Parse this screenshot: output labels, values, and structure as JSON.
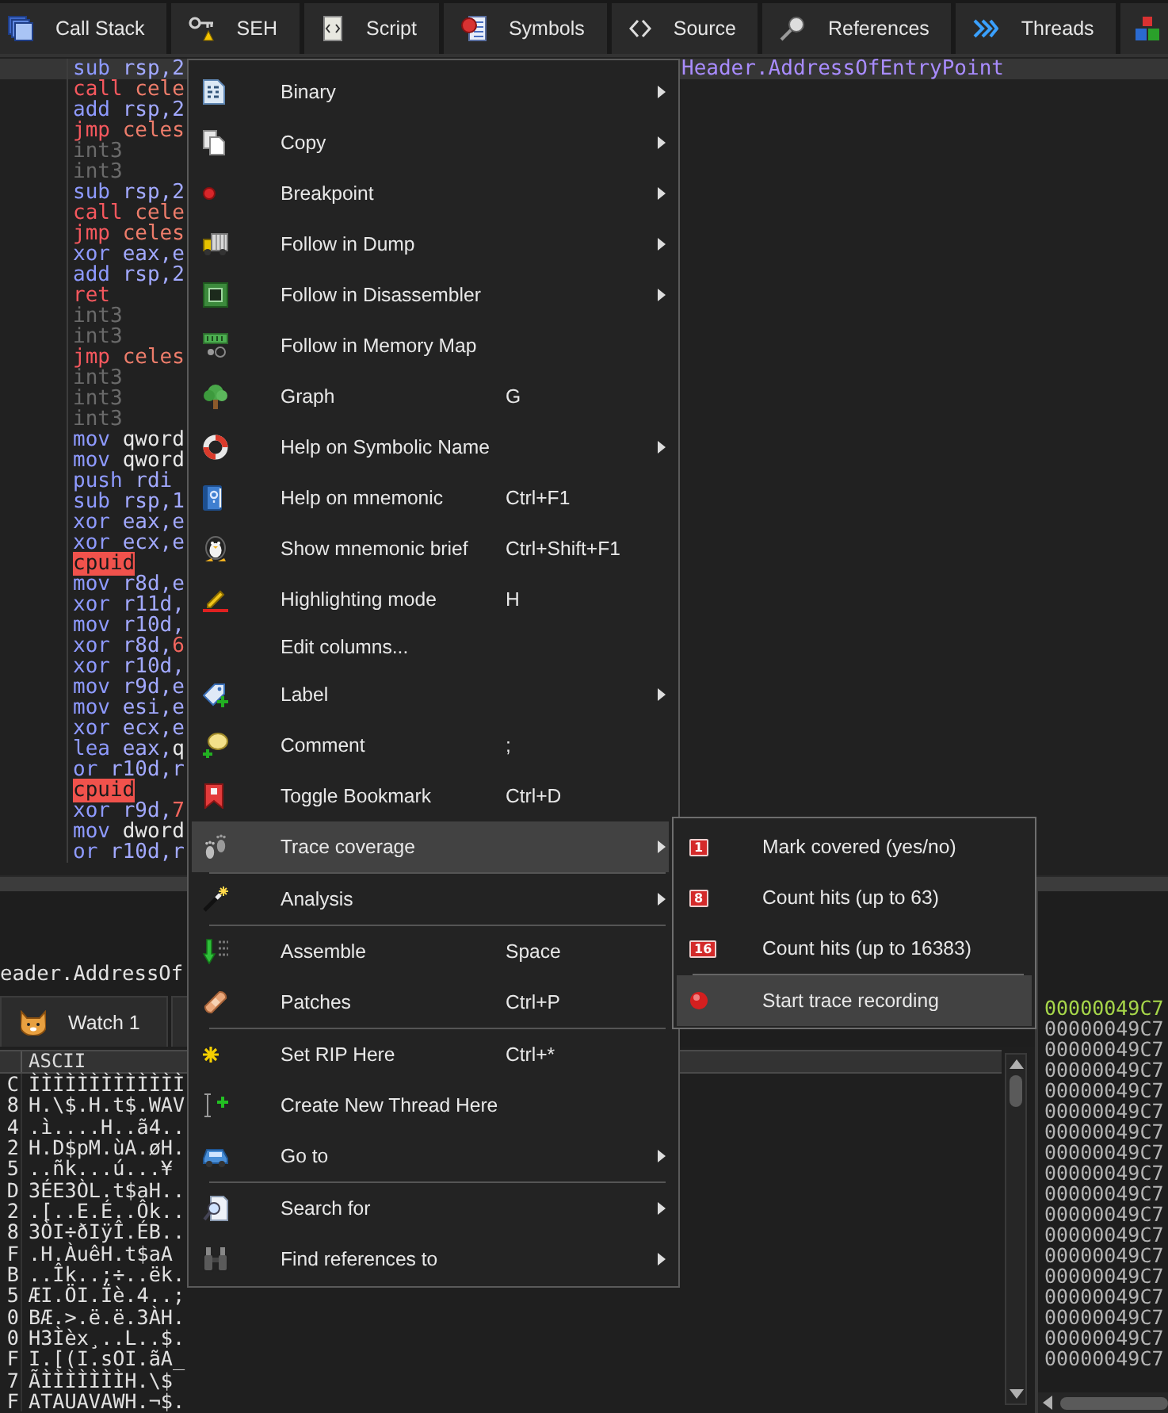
{
  "toolbar_tabs": [
    {
      "label": "Call Stack",
      "selected": false
    },
    {
      "label": "SEH",
      "selected": false
    },
    {
      "label": "Script",
      "selected": false
    },
    {
      "label": "Symbols",
      "selected": false
    },
    {
      "label": "Source",
      "selected": false
    },
    {
      "label": "References",
      "selected": false
    },
    {
      "label": "Threads",
      "selected": false
    },
    {
      "selected": false
    }
  ],
  "disassembly": {
    "lines": [
      {
        "mnemonic": "sub",
        "kind": "arith",
        "operands": [
          {
            "text": "rsp,2",
            "kind": "reg"
          }
        ],
        "comment": "Header.AddressOfEntryPoint",
        "selected": true
      },
      {
        "mnemonic": "call",
        "kind": "branch",
        "operands": [
          {
            "text": "cele",
            "kind": "symbol"
          }
        ],
        "selected": false
      },
      {
        "mnemonic": "add",
        "kind": "arith",
        "operands": [
          {
            "text": "rsp,2",
            "kind": "reg"
          }
        ],
        "selected": false
      },
      {
        "mnemonic": "jmp",
        "kind": "branch",
        "operands": [
          {
            "text": "celes",
            "kind": "symbol"
          }
        ],
        "selected": false
      },
      {
        "mnemonic": "int3",
        "kind": "filler",
        "selected": false
      },
      {
        "mnemonic": "int3",
        "kind": "filler",
        "selected": false
      },
      {
        "mnemonic": "sub",
        "kind": "arith",
        "operands": [
          {
            "text": "rsp,2",
            "kind": "reg"
          }
        ],
        "selected": false
      },
      {
        "mnemonic": "call",
        "kind": "branch",
        "operands": [
          {
            "text": "cele",
            "kind": "symbol"
          }
        ],
        "selected": false
      },
      {
        "mnemonic": "jmp",
        "kind": "branch",
        "operands": [
          {
            "text": "celes",
            "kind": "symbol"
          }
        ],
        "selected": false
      },
      {
        "mnemonic": "xor",
        "kind": "arith",
        "operands": [
          {
            "text": "eax,e",
            "kind": "reg"
          }
        ],
        "selected": false
      },
      {
        "mnemonic": "add",
        "kind": "arith",
        "operands": [
          {
            "text": "rsp,2",
            "kind": "reg"
          }
        ],
        "selected": false
      },
      {
        "mnemonic": "ret",
        "kind": "branch",
        "selected": false
      },
      {
        "mnemonic": "int3",
        "kind": "filler",
        "selected": false
      },
      {
        "mnemonic": "int3",
        "kind": "filler",
        "selected": false
      },
      {
        "mnemonic": "jmp",
        "kind": "branch",
        "operands": [
          {
            "text": "celes",
            "kind": "symbol"
          }
        ],
        "selected": false
      },
      {
        "mnemonic": "int3",
        "kind": "filler",
        "selected": false
      },
      {
        "mnemonic": "int3",
        "kind": "filler",
        "selected": false
      },
      {
        "mnemonic": "int3",
        "kind": "filler",
        "selected": false
      },
      {
        "mnemonic": "mov",
        "kind": "arith",
        "operands": [
          {
            "text": "qword",
            "kind": "mem"
          }
        ],
        "selected": false
      },
      {
        "mnemonic": "mov",
        "kind": "arith",
        "operands": [
          {
            "text": "qword",
            "kind": "mem"
          }
        ],
        "selected": false
      },
      {
        "mnemonic": "push",
        "kind": "arith",
        "operands": [
          {
            "text": "rdi",
            "kind": "reg"
          }
        ],
        "selected": false
      },
      {
        "mnemonic": "sub",
        "kind": "arith",
        "operands": [
          {
            "text": "rsp,1",
            "kind": "reg"
          }
        ],
        "selected": false
      },
      {
        "mnemonic": "xor",
        "kind": "arith",
        "operands": [
          {
            "text": "eax,e",
            "kind": "reg"
          }
        ],
        "selected": false
      },
      {
        "mnemonic": "xor",
        "kind": "arith",
        "operands": [
          {
            "text": "ecx,e",
            "kind": "reg"
          }
        ],
        "selected": false
      },
      {
        "mnemonic": "cpuid",
        "kind": "flagged",
        "selected": false
      },
      {
        "mnemonic": "mov",
        "kind": "arith",
        "operands": [
          {
            "text": "r8d,e",
            "kind": "reg"
          }
        ],
        "selected": false
      },
      {
        "mnemonic": "xor",
        "kind": "arith",
        "operands": [
          {
            "text": "r11d,",
            "kind": "reg"
          }
        ],
        "selected": false
      },
      {
        "mnemonic": "mov",
        "kind": "arith",
        "operands": [
          {
            "text": "r10d,",
            "kind": "reg"
          }
        ],
        "selected": false
      },
      {
        "mnemonic": "xor",
        "kind": "arith",
        "operands": [
          {
            "text": "r8d,",
            "kind": "reg"
          },
          {
            "text": "6",
            "kind": "imm"
          }
        ],
        "selected": false
      },
      {
        "mnemonic": "xor",
        "kind": "arith",
        "operands": [
          {
            "text": "r10d,",
            "kind": "reg"
          }
        ],
        "selected": false
      },
      {
        "mnemonic": "mov",
        "kind": "arith",
        "operands": [
          {
            "text": "r9d,e",
            "kind": "reg"
          }
        ],
        "selected": false
      },
      {
        "mnemonic": "mov",
        "kind": "arith",
        "operands": [
          {
            "text": "esi,e",
            "kind": "reg"
          }
        ],
        "selected": false
      },
      {
        "mnemonic": "xor",
        "kind": "arith",
        "operands": [
          {
            "text": "ecx,e",
            "kind": "reg"
          }
        ],
        "selected": false
      },
      {
        "mnemonic": "lea",
        "kind": "arith",
        "operands": [
          {
            "text": "eax,",
            "kind": "reg"
          },
          {
            "text": "q",
            "kind": "mem"
          }
        ],
        "selected": false
      },
      {
        "mnemonic": "or",
        "kind": "arith",
        "operands": [
          {
            "text": "r10d,r",
            "kind": "reg"
          }
        ],
        "selected": false
      },
      {
        "mnemonic": "cpuid",
        "kind": "flagged",
        "selected": false
      },
      {
        "mnemonic": "xor",
        "kind": "arith",
        "operands": [
          {
            "text": "r9d,",
            "kind": "reg"
          },
          {
            "text": "7",
            "kind": "imm"
          }
        ],
        "selected": false
      },
      {
        "mnemonic": "mov",
        "kind": "arith",
        "operands": [
          {
            "text": "dword",
            "kind": "mem"
          }
        ],
        "selected": false
      },
      {
        "mnemonic": "or",
        "kind": "arith",
        "operands": [
          {
            "text": "r10d,r",
            "kind": "reg"
          }
        ],
        "selected": false
      }
    ]
  },
  "context_menu": {
    "items": [
      {
        "kind": "command",
        "label": "Binary",
        "submenu": true,
        "selected": false
      },
      {
        "kind": "command",
        "label": "Copy",
        "submenu": true,
        "selected": false
      },
      {
        "kind": "command",
        "label": "Breakpoint",
        "submenu": true,
        "selected": false
      },
      {
        "kind": "command",
        "label": "Follow in Dump",
        "submenu": true,
        "selected": false
      },
      {
        "kind": "command",
        "label": "Follow in Disassembler",
        "submenu": true,
        "selected": false
      },
      {
        "kind": "command",
        "label": "Follow in Memory Map",
        "submenu": false,
        "selected": false
      },
      {
        "kind": "command",
        "label": "Graph",
        "shortcut": "G",
        "submenu": false,
        "selected": false
      },
      {
        "kind": "command",
        "label": "Help on Symbolic Name",
        "submenu": true,
        "selected": false
      },
      {
        "kind": "command",
        "label": "Help on mnemonic",
        "shortcut": "Ctrl+F1",
        "submenu": false,
        "selected": false
      },
      {
        "kind": "command",
        "label": "Show mnemonic brief",
        "shortcut": "Ctrl+Shift+F1",
        "submenu": false,
        "selected": false
      },
      {
        "kind": "command",
        "label": "Highlighting mode",
        "shortcut": "H",
        "submenu": false,
        "selected": false
      },
      {
        "kind": "command",
        "label": "Edit columns...",
        "submenu": false,
        "selected": false
      },
      {
        "kind": "command",
        "label": "Label",
        "submenu": true,
        "selected": false
      },
      {
        "kind": "command",
        "label": "Comment",
        "shortcut": ";",
        "submenu": false,
        "selected": false
      },
      {
        "kind": "command",
        "label": "Toggle Bookmark",
        "shortcut": "Ctrl+D",
        "submenu": false,
        "selected": false
      },
      {
        "kind": "command",
        "label": "Trace coverage",
        "submenu": true,
        "selected": true
      },
      {
        "kind": "separator"
      },
      {
        "kind": "command",
        "label": "Analysis",
        "submenu": true,
        "selected": false
      },
      {
        "kind": "separator"
      },
      {
        "kind": "command",
        "label": "Assemble",
        "shortcut": "Space",
        "submenu": false,
        "selected": false
      },
      {
        "kind": "command",
        "label": "Patches",
        "shortcut": "Ctrl+P",
        "submenu": false,
        "selected": false
      },
      {
        "kind": "separator"
      },
      {
        "kind": "command",
        "label": "Set RIP Here",
        "shortcut": "Ctrl+*",
        "submenu": false,
        "selected": false
      },
      {
        "kind": "command",
        "label": "Create New Thread Here",
        "submenu": false,
        "selected": false
      },
      {
        "kind": "command",
        "label": "Go to",
        "submenu": true,
        "selected": false
      },
      {
        "kind": "separator"
      },
      {
        "kind": "command",
        "label": "Search for",
        "submenu": true,
        "selected": false
      },
      {
        "kind": "command",
        "label": "Find references to",
        "submenu": true,
        "selected": false
      }
    ]
  },
  "trace_coverage_submenu": {
    "items": [
      {
        "kind": "counter",
        "badge": "1",
        "label": "Mark covered (yes/no)",
        "selected": false
      },
      {
        "kind": "counter",
        "badge": "8",
        "label": "Count hits (up to 63)",
        "selected": false
      },
      {
        "kind": "counter",
        "badge": "16",
        "label": "Count hits (up to 16383)",
        "selected": false
      },
      {
        "kind": "separator"
      },
      {
        "kind": "record",
        "label": "Start trace recording",
        "selected": true
      }
    ]
  },
  "info_box": {
    "text": "eader.AddressOf"
  },
  "dump_tabs": [
    {
      "label": "Watch 1",
      "selected": false
    },
    {
      "selected": false
    }
  ],
  "dump": {
    "ascii_heading": "ASCII",
    "rows": [
      {
        "column_1": "C",
        "ascii": "ÌÌÌÌÌÌÌÌÌÌÌÌÌ"
      },
      {
        "column_1": "8",
        "ascii": "H.\\$.H.t$.WAV"
      },
      {
        "column_1": "4",
        "ascii": ".ì....H..ã4.."
      },
      {
        "column_1": "2",
        "ascii": "H.D$pM.ùA.øH."
      },
      {
        "column_1": "5",
        "ascii": "..ñk...ú...¥"
      },
      {
        "column_1": "D",
        "ascii": "3ÉE3ÒL.t$aH.."
      },
      {
        "column_1": "2",
        "ascii": ".[..E.É..Ôk.."
      },
      {
        "column_1": "8",
        "ascii": "3ÒI÷ðIÿÎ.ÉB.."
      },
      {
        "column_1": "F",
        "ascii": ".H.ÀuêH.t$aA"
      },
      {
        "column_1": "B",
        "ascii": "..Îk..;÷..ëk."
      },
      {
        "column_1": "5",
        "ascii": "ÆI.ÖI.Ïè.4..;"
      },
      {
        "column_1": "0",
        "ascii": "BÆ.>.ë.ë.3ÀH."
      },
      {
        "column_1": "0",
        "ascii": "H3Ìèx¸..L..$."
      },
      {
        "column_1": "F",
        "ascii": "I.[(I.sOI.ãA_"
      },
      {
        "column_1": "7",
        "ascii": "ÃÌÌÌÌÌÌÌH.\\$"
      },
      {
        "column_1": "F",
        "ascii": "ATAUAVAWH.¬$."
      }
    ]
  },
  "stack": {
    "rows": [
      {
        "address": "00000049C7",
        "current": true
      },
      {
        "address": "00000049C7",
        "current": false
      },
      {
        "address": "00000049C7",
        "current": false
      },
      {
        "address": "00000049C7",
        "current": false
      },
      {
        "address": "00000049C7",
        "current": false
      },
      {
        "address": "00000049C7",
        "current": false
      },
      {
        "address": "00000049C7",
        "current": false
      },
      {
        "address": "00000049C7",
        "current": false
      },
      {
        "address": "00000049C7",
        "current": false
      },
      {
        "address": "00000049C7",
        "current": false
      },
      {
        "address": "00000049C7",
        "current": false
      },
      {
        "address": "00000049C7",
        "current": false
      },
      {
        "address": "00000049C7",
        "current": false
      },
      {
        "address": "00000049C7",
        "current": false
      },
      {
        "address": "00000049C7",
        "current": false
      },
      {
        "address": "00000049C7",
        "current": false
      },
      {
        "address": "00000049C7",
        "current": false
      },
      {
        "address": "00000049C7",
        "current": false
      }
    ]
  }
}
